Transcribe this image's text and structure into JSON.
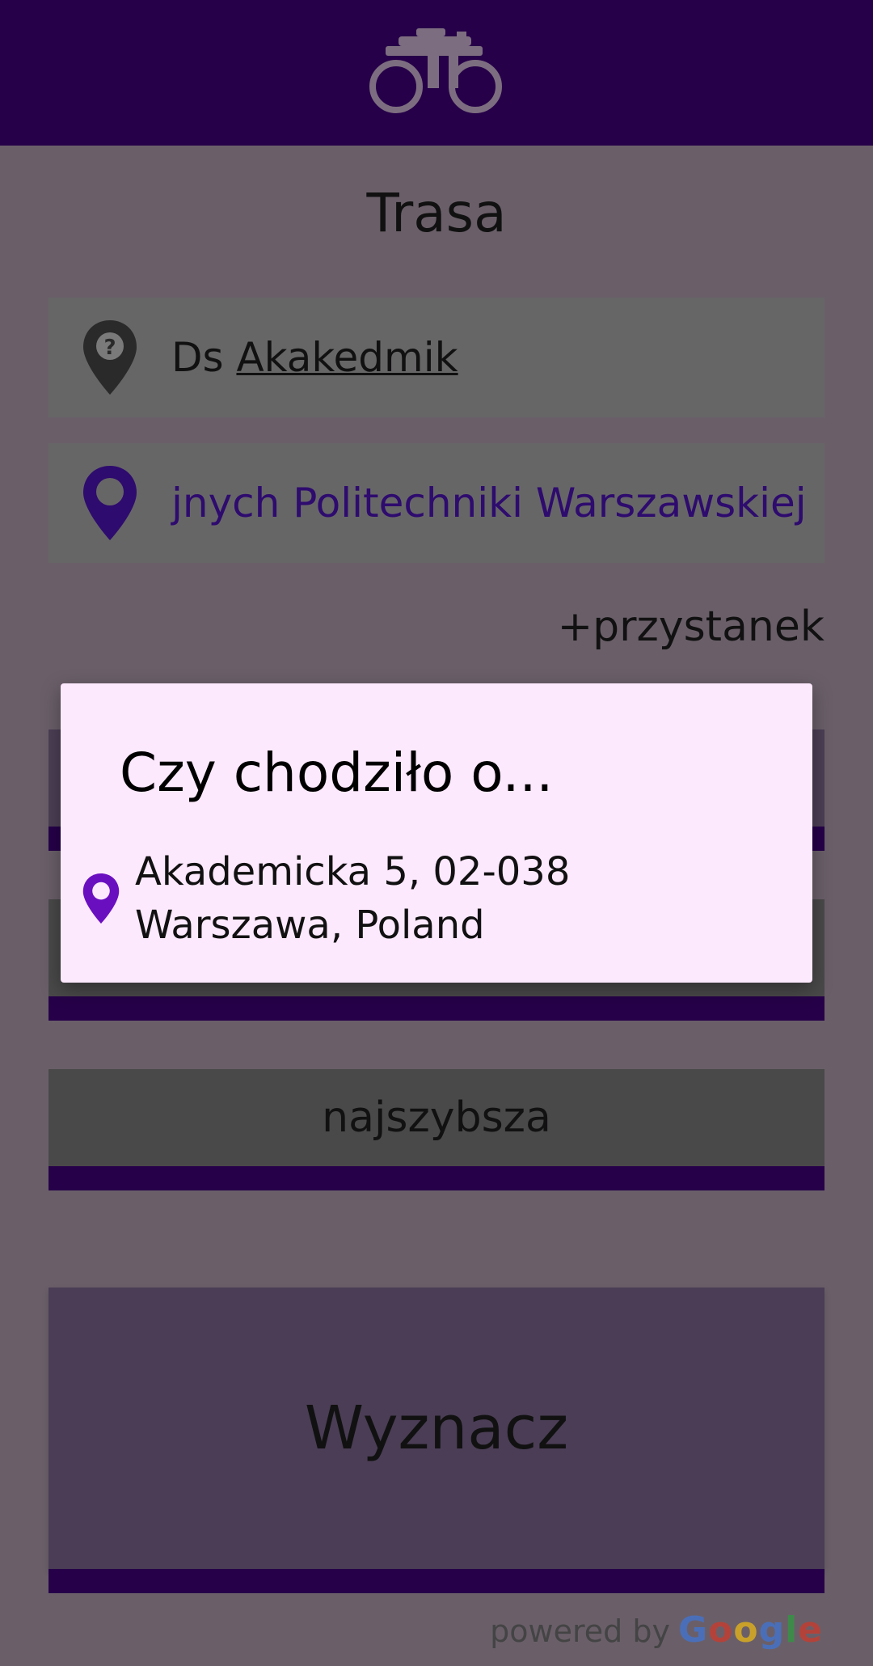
{
  "header": {
    "logo_icon": "bicycle-icon",
    "logo_color": "#7d6d80",
    "background": "#260049"
  },
  "page": {
    "title": "Trasa"
  },
  "route": {
    "origin": {
      "prefix": "Ds ",
      "underlined": "Akakedmik",
      "icon": "unknown-location-pin-icon"
    },
    "destination": {
      "text": "jnych Politechniki Warszawskiej",
      "icon": "location-pin-icon",
      "color": "#2e0b6e"
    },
    "add_stop_label": "+przystanek"
  },
  "options": {
    "route_type": "najszybsza"
  },
  "actions": {
    "calculate_label": "Wyznacz"
  },
  "footer": {
    "powered_by": "powered by",
    "brand": "Google"
  },
  "dialog": {
    "title": "Czy chodziło o...",
    "suggestion_line1": "Akademicka 5, 02-038",
    "suggestion_line2": "Warszawa, Poland",
    "pin_color": "#6a0fc0"
  }
}
